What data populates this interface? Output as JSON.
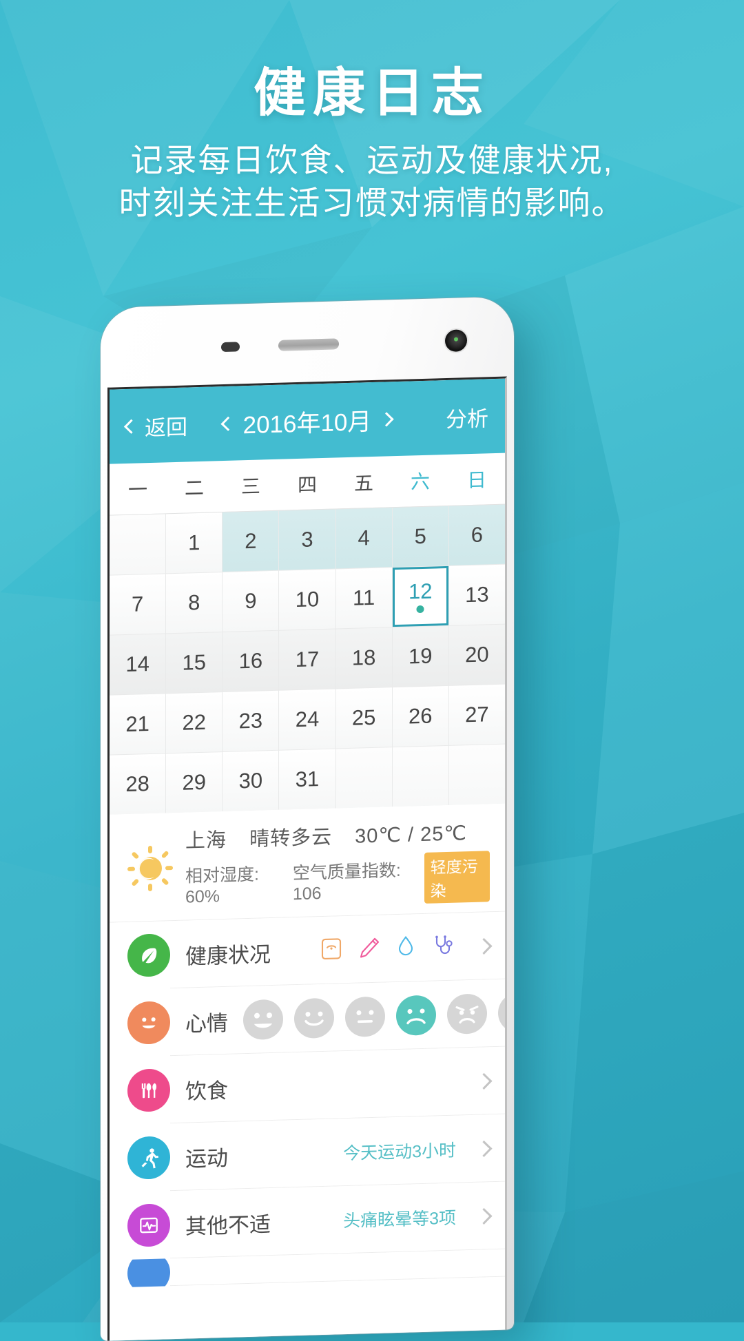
{
  "hero": {
    "title": "健康日志",
    "subtitle_line1": "记录每日饮食、运动及健康状况,",
    "subtitle_line2": "时刻关注生活习惯对病情的影响。"
  },
  "colors": {
    "bg_teal": "#3fbcd0",
    "navbar": "#43bcd0",
    "accent": "#2e9fb3",
    "selected_dot": "#36b2a0",
    "badge_orange": "#f5b94f",
    "value_text": "#56bfc6"
  },
  "app": {
    "navbar": {
      "back_label": "返回",
      "month_title": "2016年10月",
      "right_label": "分析",
      "prev_icon": "chevron-left-icon",
      "next_icon": "chevron-right-icon"
    },
    "calendar": {
      "weekdays": [
        "一",
        "二",
        "三",
        "四",
        "五",
        "六",
        "日"
      ],
      "weekend_indexes": [
        5,
        6
      ],
      "leading_blanks": 1,
      "days": [
        1,
        2,
        3,
        4,
        5,
        6,
        7,
        8,
        9,
        10,
        11,
        12,
        13,
        14,
        15,
        16,
        17,
        18,
        19,
        20,
        21,
        22,
        23,
        24,
        25,
        26,
        27,
        28,
        29,
        30,
        31
      ],
      "selected_day": 12,
      "selected_has_dot": true,
      "shaded_days": [
        2,
        3,
        4,
        5,
        6
      ],
      "trailing_blanks": 3
    },
    "weather": {
      "icon": "sun-moon-icon",
      "city": "上海",
      "condition": "晴转多云",
      "temperature": "30℃ / 25℃",
      "humidity_label": "相对湿度: 60%",
      "aqi_label": "空气质量指数: 106",
      "aqi_badge": "轻度污染"
    },
    "list": [
      {
        "id": "health-status",
        "label": "健康状况",
        "icon": "leaf-icon",
        "icon_color": "#45b649",
        "value": "",
        "mini_icons": [
          "scale-icon",
          "thermometer-icon",
          "blood-drop-icon",
          "stethoscope-icon"
        ],
        "chevron": "chevron-right-icon"
      },
      {
        "id": "mood",
        "label": "心情",
        "icon": "smiley-icon",
        "icon_color": "#f08a5d",
        "moods": [
          "happy",
          "smile",
          "neutral",
          "sad",
          "worried",
          "upset"
        ],
        "selected_mood_index": 3
      },
      {
        "id": "diet",
        "label": "饮食",
        "icon": "cutlery-icon",
        "icon_color": "#ee4b8b",
        "value": "",
        "chevron": "chevron-right-icon"
      },
      {
        "id": "exercise",
        "label": "运动",
        "icon": "runner-icon",
        "icon_color": "#2fb4d6",
        "value": "今天运动3小时",
        "chevron": "chevron-right-icon"
      },
      {
        "id": "other-discomfort",
        "label": "其他不适",
        "icon": "pulse-icon",
        "icon_color": "#c74bd6",
        "value": "头痛眩晕等3项",
        "chevron": "chevron-right-icon"
      }
    ]
  }
}
